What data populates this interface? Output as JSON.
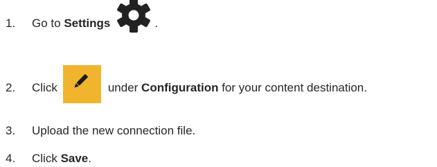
{
  "steps": [
    {
      "number": "1.",
      "text_before": "Go to ",
      "bold": "Settings",
      "icon": "gear-icon",
      "text_after": "."
    },
    {
      "number": "2.",
      "text_before": "Click",
      "icon": "edit-pencil-icon",
      "icon_color": "#f0b52d",
      "text_middle": "under ",
      "bold": "Configuration",
      "text_after": " for your content destination."
    },
    {
      "number": "3.",
      "text": "Upload the new connection file."
    },
    {
      "number": "4.",
      "text_before": "Click ",
      "bold": "Save",
      "text_after": "."
    }
  ]
}
